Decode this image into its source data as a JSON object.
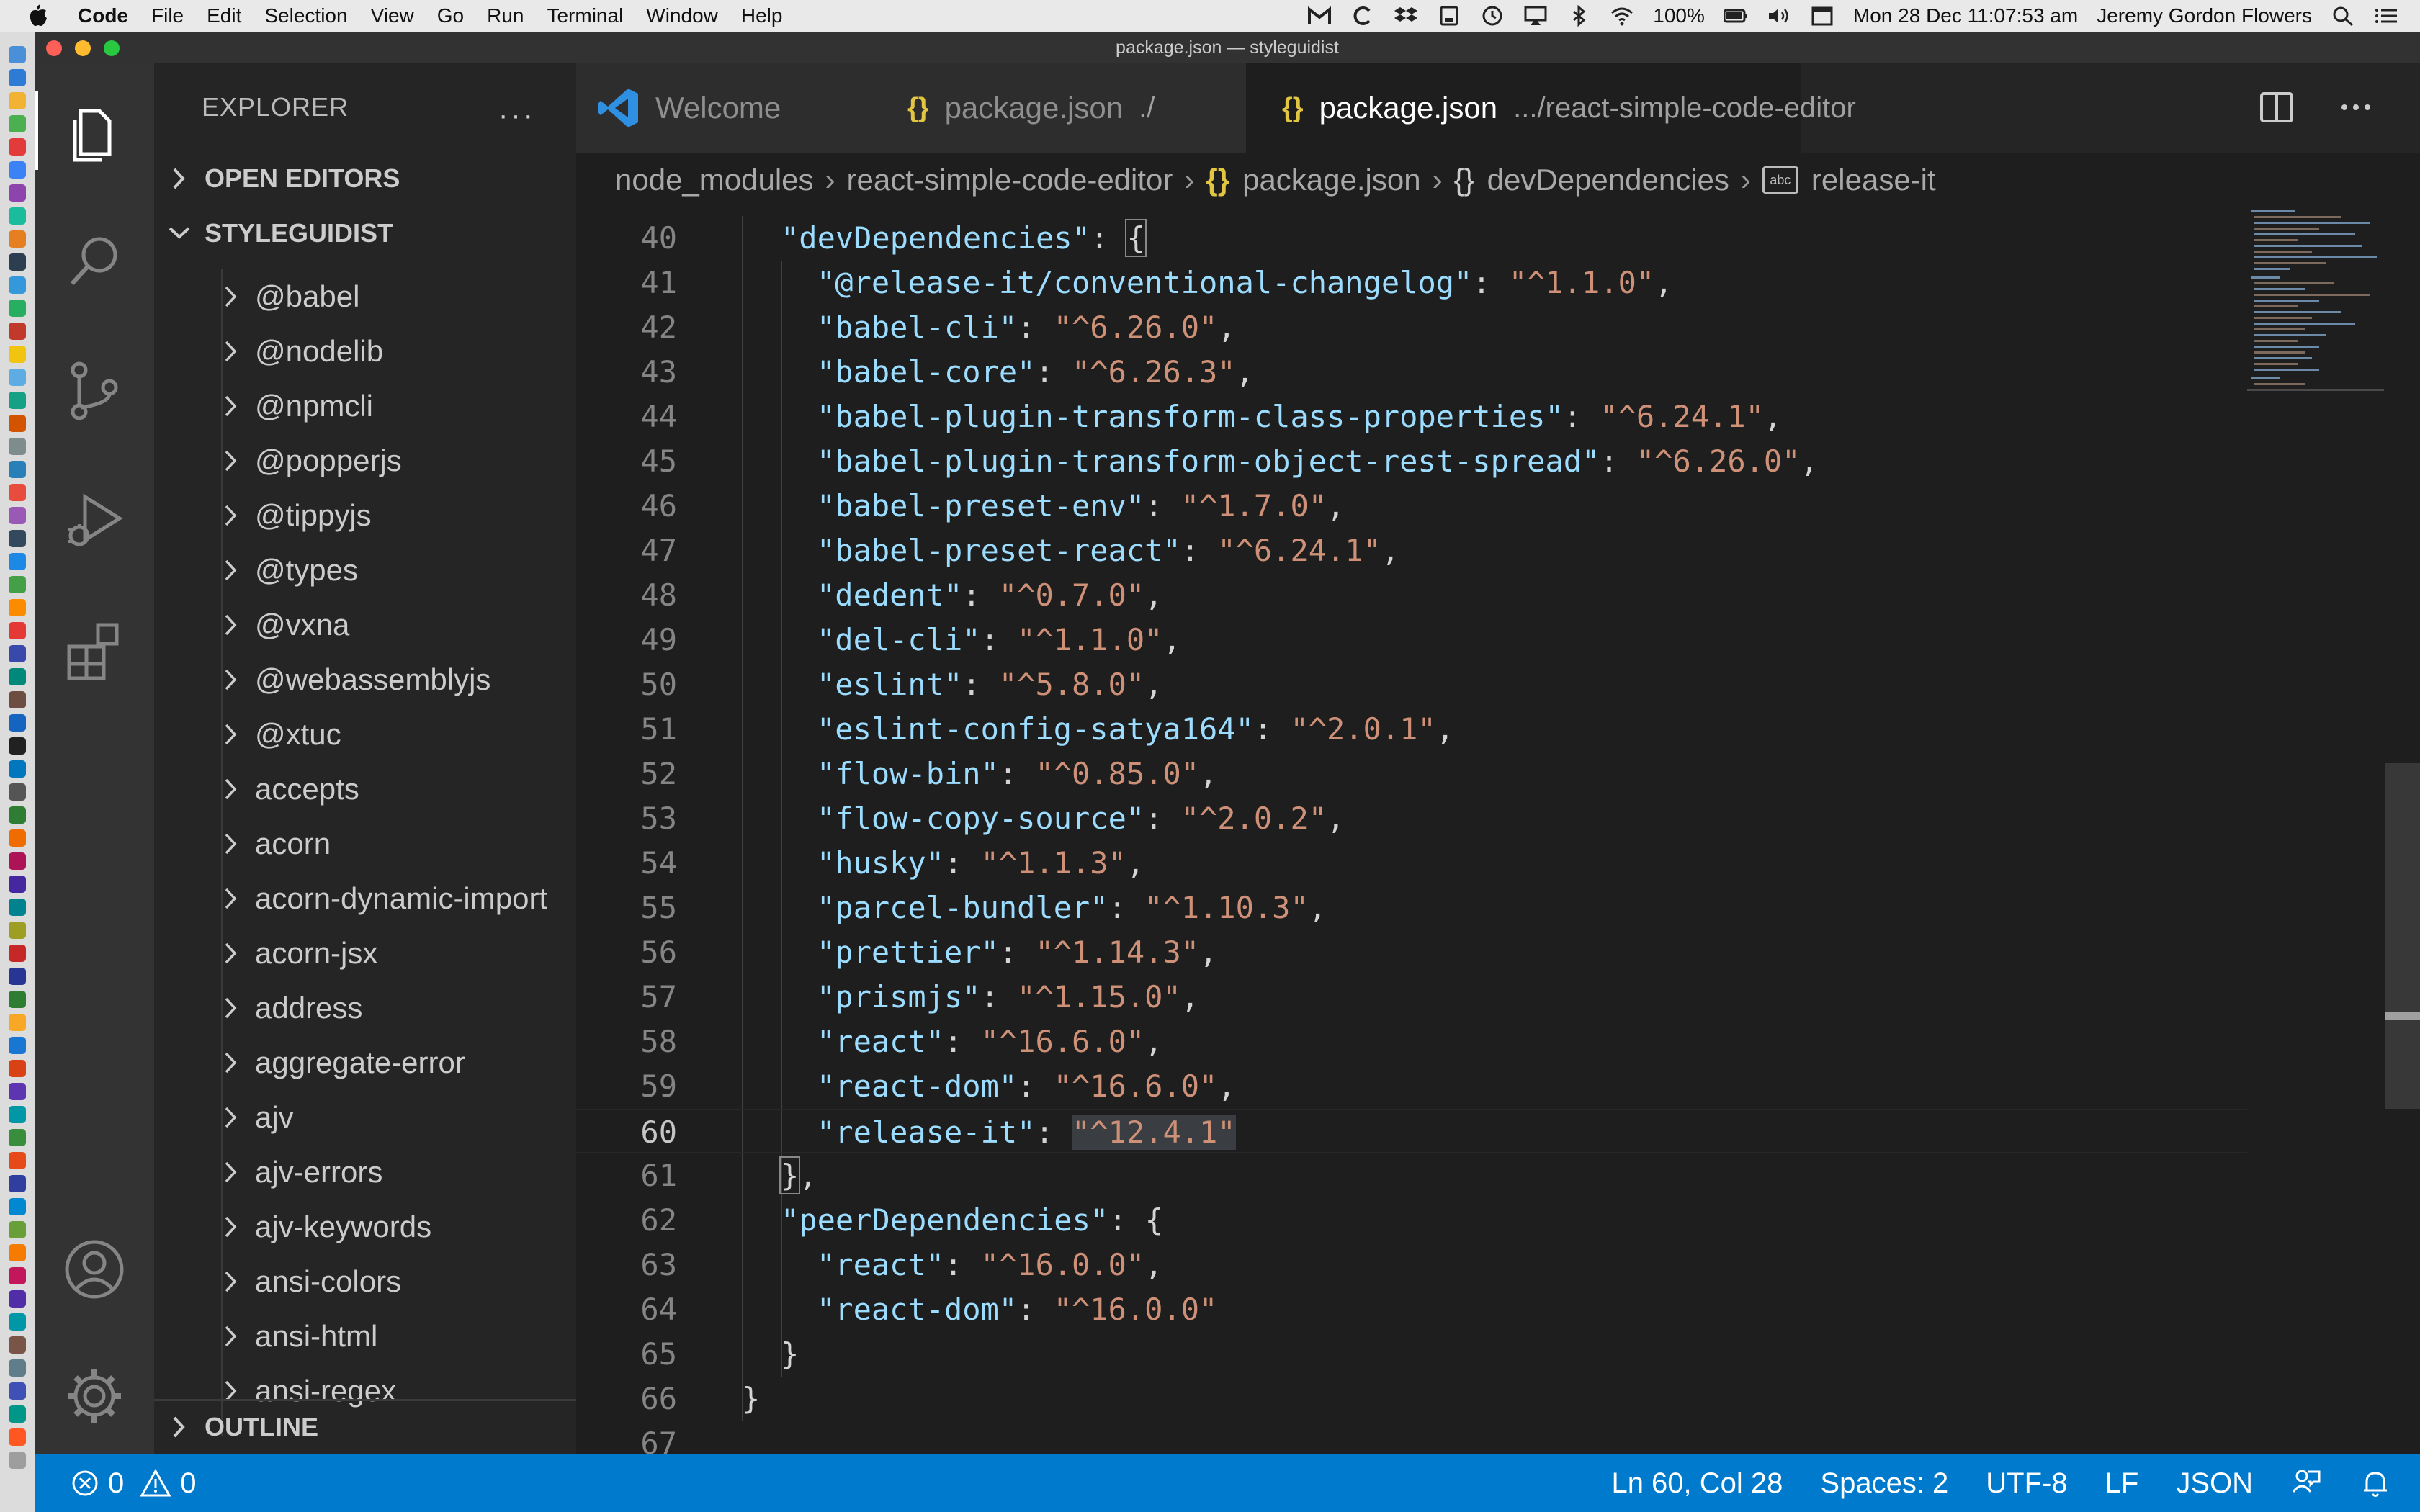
{
  "menubar": {
    "app_name": "Code",
    "items": [
      "File",
      "Edit",
      "Selection",
      "View",
      "Go",
      "Run",
      "Terminal",
      "Window",
      "Help"
    ],
    "battery": "100%",
    "datetime": "Mon 28 Dec  11:07:53 am",
    "user": "Jeremy Gordon Flowers"
  },
  "window": {
    "title": "package.json — styleguidist"
  },
  "sidebar": {
    "header": "EXPLORER",
    "more_label": "···",
    "open_editors": "OPEN EDITORS",
    "workspace": "STYLEGUIDIST",
    "outline": "OUTLINE",
    "tree": [
      "@babel",
      "@nodelib",
      "@npmcli",
      "@popperjs",
      "@tippyjs",
      "@types",
      "@vxna",
      "@webassemblyjs",
      "@xtuc",
      "accepts",
      "acorn",
      "acorn-dynamic-import",
      "acorn-jsx",
      "address",
      "aggregate-error",
      "ajv",
      "ajv-errors",
      "ajv-keywords",
      "ansi-colors",
      "ansi-html",
      "ansi-regex"
    ]
  },
  "tabs": [
    {
      "label": "Welcome",
      "icon": "vscode-logo-icon",
      "desc": ""
    },
    {
      "label": "package.json",
      "icon": "json-icon",
      "desc": "./"
    },
    {
      "label": "package.json",
      "icon": "json-icon",
      "desc": ".../react-simple-code-editor"
    }
  ],
  "breadcrumb": {
    "parts": [
      "node_modules",
      "react-simple-code-editor",
      "package.json",
      "devDependencies",
      "release-it"
    ],
    "abc": "abc"
  },
  "editor": {
    "lines": [
      {
        "n": "40",
        "indent": 1,
        "key": "devDependencies",
        "val": null,
        "tail": ": {",
        "bracket": true
      },
      {
        "n": "41",
        "indent": 2,
        "key": "@release-it/conventional-changelog",
        "val": "^1.1.0",
        "tail": ","
      },
      {
        "n": "42",
        "indent": 2,
        "key": "babel-cli",
        "val": "^6.26.0",
        "tail": ","
      },
      {
        "n": "43",
        "indent": 2,
        "key": "babel-core",
        "val": "^6.26.3",
        "tail": ","
      },
      {
        "n": "44",
        "indent": 2,
        "key": "babel-plugin-transform-class-properties",
        "val": "^6.24.1",
        "tail": ","
      },
      {
        "n": "45",
        "indent": 2,
        "key": "babel-plugin-transform-object-rest-spread",
        "val": "^6.26.0",
        "tail": ","
      },
      {
        "n": "46",
        "indent": 2,
        "key": "babel-preset-env",
        "val": "^1.7.0",
        "tail": ","
      },
      {
        "n": "47",
        "indent": 2,
        "key": "babel-preset-react",
        "val": "^6.24.1",
        "tail": ","
      },
      {
        "n": "48",
        "indent": 2,
        "key": "dedent",
        "val": "^0.7.0",
        "tail": ","
      },
      {
        "n": "49",
        "indent": 2,
        "key": "del-cli",
        "val": "^1.1.0",
        "tail": ","
      },
      {
        "n": "50",
        "indent": 2,
        "key": "eslint",
        "val": "^5.8.0",
        "tail": ","
      },
      {
        "n": "51",
        "indent": 2,
        "key": "eslint-config-satya164",
        "val": "^2.0.1",
        "tail": ","
      },
      {
        "n": "52",
        "indent": 2,
        "key": "flow-bin",
        "val": "^0.85.0",
        "tail": ","
      },
      {
        "n": "53",
        "indent": 2,
        "key": "flow-copy-source",
        "val": "^2.0.2",
        "tail": ","
      },
      {
        "n": "54",
        "indent": 2,
        "key": "husky",
        "val": "^1.1.3",
        "tail": ","
      },
      {
        "n": "55",
        "indent": 2,
        "key": "parcel-bundler",
        "val": "^1.10.3",
        "tail": ","
      },
      {
        "n": "56",
        "indent": 2,
        "key": "prettier",
        "val": "^1.14.3",
        "tail": ","
      },
      {
        "n": "57",
        "indent": 2,
        "key": "prismjs",
        "val": "^1.15.0",
        "tail": ","
      },
      {
        "n": "58",
        "indent": 2,
        "key": "react",
        "val": "^16.6.0",
        "tail": ","
      },
      {
        "n": "59",
        "indent": 2,
        "key": "react-dom",
        "val": "^16.6.0",
        "tail": ","
      },
      {
        "n": "60",
        "indent": 2,
        "key": "release-it",
        "val": "^12.4.1",
        "tail": "",
        "current": true,
        "selected": true
      },
      {
        "n": "61",
        "indent": 1,
        "key": null,
        "val": null,
        "tail": "},",
        "bracket_close": true
      },
      {
        "n": "62",
        "indent": 1,
        "key": "peerDependencies",
        "val": null,
        "tail": ": {"
      },
      {
        "n": "63",
        "indent": 2,
        "key": "react",
        "val": "^16.0.0",
        "tail": ","
      },
      {
        "n": "64",
        "indent": 2,
        "key": "react-dom",
        "val": "^16.0.0",
        "tail": ""
      },
      {
        "n": "65",
        "indent": 1,
        "key": null,
        "val": null,
        "tail": "}"
      },
      {
        "n": "66",
        "indent": 0,
        "key": null,
        "val": null,
        "tail": "}"
      },
      {
        "n": "67",
        "indent": 0,
        "key": null,
        "val": null,
        "tail": ""
      }
    ]
  },
  "statusbar": {
    "errors": "0",
    "warnings": "0",
    "position": "Ln 60, Col 28",
    "spaces": "Spaces: 2",
    "encoding": "UTF-8",
    "eol": "LF",
    "language": "JSON"
  },
  "colors": {
    "statusbar": "#007acc",
    "json_key": "#9cdcfe",
    "json_string": "#ce9178",
    "json_curly": "#e2c541"
  }
}
